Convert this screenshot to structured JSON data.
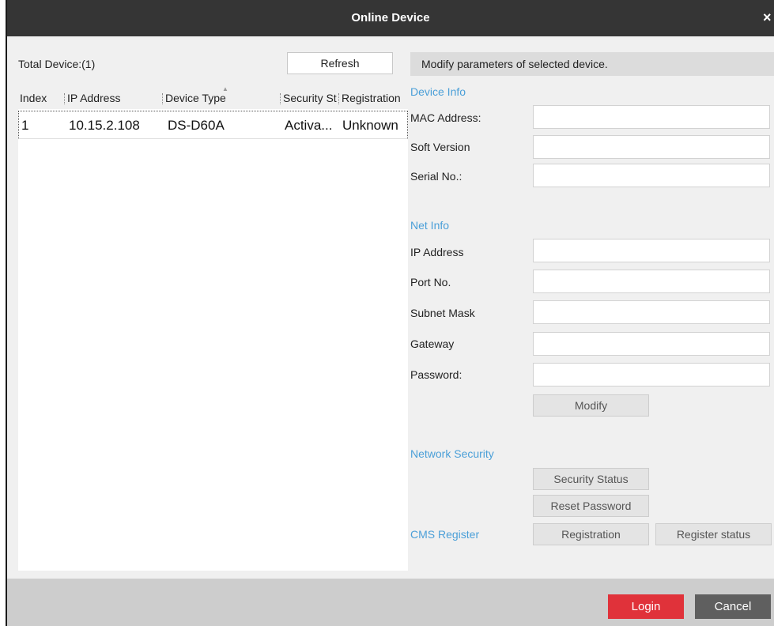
{
  "window": {
    "title": "Online Device",
    "close_icon": "×"
  },
  "left": {
    "total_label": "Total Device:(1)",
    "refresh_label": "Refresh",
    "columns": [
      "Index",
      "IP Address",
      "Device Type",
      "Security Status",
      "Registration"
    ],
    "rows": [
      {
        "index": "1",
        "ip": "10.15.2.108",
        "type": "DS-D60A",
        "security": "Activa...",
        "registration": "Unknown"
      }
    ]
  },
  "right": {
    "hint": "Modify parameters of selected device.",
    "device_info": {
      "heading": "Device Info",
      "mac_label": "MAC Address:",
      "soft_label": "Soft Version",
      "serial_label": "Serial No.:"
    },
    "net_info": {
      "heading": "Net Info",
      "ip_label": "IP Address",
      "port_label": "Port No.",
      "subnet_label": "Subnet Mask",
      "gateway_label": "Gateway",
      "password_label": "Password:",
      "modify_label": "Modify"
    },
    "network_security": {
      "heading": "Network Security",
      "security_status_label": "Security Status",
      "reset_password_label": "Reset Password"
    },
    "cms": {
      "heading": "CMS Register",
      "registration_label": "Registration",
      "register_status_label": "Register status"
    }
  },
  "footer": {
    "login_label": "Login",
    "cancel_label": "Cancel"
  },
  "colors": {
    "titlebar": "#353535",
    "accent_blue": "#4a9fd8",
    "login_red": "#e0323a",
    "cancel_gray": "#5f5f5f"
  }
}
